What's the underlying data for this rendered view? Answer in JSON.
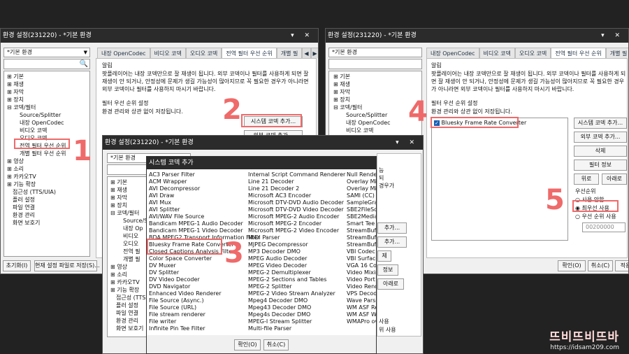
{
  "left": {
    "title": "환경 설정(231220) - *기본 환경",
    "win_controls": "▾ ✕",
    "profile": "*기본 환경",
    "tabs": [
      "내장 OpenCodec",
      "비디오 코덱",
      "오디오 코덱",
      "전역 필터 우선 순위",
      "개별 필"
    ],
    "tree": [
      "기본",
      "재생",
      "자막",
      "장치",
      "코덱/필터",
      "Source/Splitter",
      "내장 OpenCodec",
      "비디오 코덱",
      "오디오 코덱",
      "전역 필터 우선 순위",
      "개별 필터 우선 순위",
      "영상",
      "소리",
      "카카오TV",
      "기능 확장",
      "접근성 (TTS/UIA)",
      "플러 설정",
      "파일 연결",
      "환경 관리",
      "화면 보호기"
    ],
    "notice_title": "알림",
    "notice": "팟플레이어는 내장 코덱만으로 잘 재생이 됩니다. 외부 코덱이나 필터를 사용하게 되면 잘 재생이 안 되거나, 안정성에 문제가 생길 가능성이 많아지므로 꼭 필요한 경우가 아니라면 외부 코덱이나 필터를 사용하지 마시기 바랍니다.",
    "priority_title": "필터 우선 순위 설정",
    "priority_desc": "환경 관리와 상관 없이 저장됩니다.",
    "btn_system": "시스템 코덱 추가...",
    "btn_external": "외부 코덱 추가...",
    "btn_reset": "초기화(I)",
    "btn_save": "현재 설정 파일로 저장(S)..."
  },
  "right": {
    "title": "환경 설정(231220) - *기본 환경",
    "win_controls": "▾ ✕",
    "profile": "*기본 환경",
    "tabs": [
      "내장 OpenCodec",
      "비디오 코덱",
      "오디오 코덱",
      "전역 필터 우선 순위",
      "개별 필"
    ],
    "tree": [
      "기본",
      "재생",
      "자막",
      "장치",
      "코덱/필터",
      "Source/Splitter",
      "내장 OpenCodec",
      "비디오 코덱"
    ],
    "notice_title": "알림",
    "notice": "팟플레이어는 내장 코덱만으로 잘 재생이 됩니다. 외부 코덱이나 필터를 사용하게 되면 잘 재생이 안 되거나, 안정성에 문제가 생길 가능성이 많아지므로 꼭 필요한 경우가 아니라면 외부 코덱이나 필터를 사용하지 마시기 바랍니다.",
    "priority_title": "필터 우선 순위 설정",
    "priority_desc": "환경 관리와 상관 없이 저장됩니다.",
    "list_item": "Bluesky Frame Rate Converter",
    "btn_system": "시스템 코덱 추가...",
    "btn_external": "외부 코덱 추가...",
    "btn_delete": "삭제",
    "btn_info": "필터 정보",
    "btn_up": "위로",
    "btn_down": "아래로",
    "priority_label": "우선순위",
    "radio_none": "사용 안함",
    "radio_top": "최우선 사용",
    "radio_cond": "우선 순위 사용",
    "merit": "00200000",
    "btn_ok": "확인(O)",
    "btn_cancel": "취소(C)",
    "btn_apply": "적용"
  },
  "middle": {
    "title": "환경 설정(231220) - *기본 환경",
    "win_controls": "▾ ✕",
    "profile": "*기본 환경",
    "tree": [
      "기본",
      "재생",
      "자막",
      "장치",
      "코덱/필터",
      "Source/S",
      "내장 Op",
      "비디오",
      "오디오",
      "전역 필",
      "개별 필",
      "영상",
      "소리",
      "카카오TV",
      "기능 확장",
      "접근성 (TTS",
      "플러 설정",
      "파일 연결",
      "환경 관리",
      "화면 보호기"
    ],
    "side_labels": [
      "능",
      "되",
      "경우가",
      "추가...",
      "추가...",
      "제",
      "정보",
      "아래로",
      "사용",
      "위 사용"
    ]
  },
  "codec": {
    "title": "시스템 코덱 추가",
    "col1": [
      "AC3 Parser Filter",
      "ACM Wrapper",
      "AVI Decompressor",
      "AVI Draw",
      "AVI Mux",
      "AVI Splitter",
      "AVI/WAV File Source",
      "Bandicam MPEG-1 Audio Decoder",
      "Bandicam MPEG-1 Video Decoder",
      "BDA MPEG2 Transport Information Filter",
      "Bluesky Frame Rate Converter",
      "Closed Captions Analysis Filter",
      "Color Space Converter",
      "DV Muxer",
      "DV Splitter",
      "DV Video Decoder",
      "DVD Navigator",
      "Enhanced Video Renderer",
      "File Source (Async.)",
      "File Source (URL)",
      "File stream renderer",
      "File writer",
      "Infinite Pin Tee Filter"
    ],
    "col2": [
      "Internal Script Command Renderer",
      "Line 21 Decoder",
      "Line 21 Decoder 2",
      "Microsoft AC3 Encoder",
      "Microsoft DTV-DVD Audio Decoder",
      "Microsoft DTV-DVD Video Decoder",
      "Microsoft MPEG-2 Audio Encoder",
      "Microsoft MPEG-2 Encoder",
      "Microsoft MPEG-2 Video Encoder",
      "MIDI Parser",
      "MJPEG Decompressor",
      "MP3 Decoder DMO",
      "MPEG Audio Decoder",
      "MPEG Video Decoder",
      "MPEG-2 Demultiplexer",
      "MPEG-2 Sections and Tables",
      "MPEG-2 Splitter",
      "MPEG-2 Video Stream Analyzer",
      "Mpeg4 Decoder DMO",
      "Mpeg43 Decoder DMO",
      "Mpeg4s Decoder DMO",
      "MPEG-I Stream Splitter",
      "Multi-file Parser"
    ],
    "col3": [
      "Null Renderer",
      "Overlay Mixer",
      "Overlay Mixer2",
      "SAMI (CC) Parser",
      "SampleGrabber",
      "SBE2FileScan",
      "SBE2MediaTypeProfile",
      "Smart Tee",
      "StreamBufferSink",
      "StreamBufferSource",
      "StreamBufferSink2",
      "VBI Codec",
      "VBI Surface Allocator",
      "VGA 16 Color Ditherer",
      "Video Mixing Renderer 9",
      "Video Port Manager",
      "Video Renderer",
      "VPS Decoder",
      "Wave Parser",
      "WM ASF Reader",
      "WM ASF Writer",
      "WMAPro over S/PDIF"
    ],
    "btn_ok": "확인(O)",
    "btn_cancel": "취소(C)"
  },
  "annotations": [
    "1",
    "2",
    "3",
    "4",
    "5"
  ],
  "watermark": {
    "brand": "뜨비뜨비뜨바",
    "url": "https://idsam209.com"
  }
}
